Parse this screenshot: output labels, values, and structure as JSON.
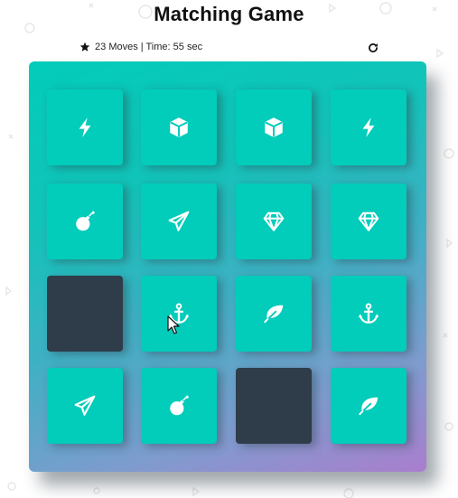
{
  "title": "Matching Game",
  "score_panel": {
    "star_icon": "star-icon",
    "moves": "23",
    "moves_label": "Moves",
    "separator": "|",
    "time_label": "Time:",
    "time_value": "55 sec",
    "restart_icon": "restart-icon"
  },
  "colors": {
    "card_face": "#02ccba",
    "card_back": "#2e3d49",
    "deck_gradient_start": "#02ccba",
    "deck_gradient_end": "#aa7ecd"
  },
  "deck": {
    "rows": [
      [
        {
          "icon": "bolt",
          "state": "open"
        },
        {
          "icon": "cube",
          "state": "open"
        },
        {
          "icon": "cube",
          "state": "open"
        },
        {
          "icon": "bolt",
          "state": "open"
        }
      ],
      [
        {
          "icon": "bomb",
          "state": "open"
        },
        {
          "icon": "paper-plane",
          "state": "open"
        },
        {
          "icon": "diamond",
          "state": "open"
        },
        {
          "icon": "diamond",
          "state": "open"
        }
      ],
      [
        {
          "icon": "hidden",
          "state": "closed"
        },
        {
          "icon": "anchor",
          "state": "open"
        },
        {
          "icon": "leaf",
          "state": "open"
        },
        {
          "icon": "anchor",
          "state": "open"
        }
      ],
      [
        {
          "icon": "paper-plane",
          "state": "open"
        },
        {
          "icon": "bomb",
          "state": "open"
        },
        {
          "icon": "hidden",
          "state": "closed"
        },
        {
          "icon": "leaf",
          "state": "open"
        }
      ]
    ]
  }
}
